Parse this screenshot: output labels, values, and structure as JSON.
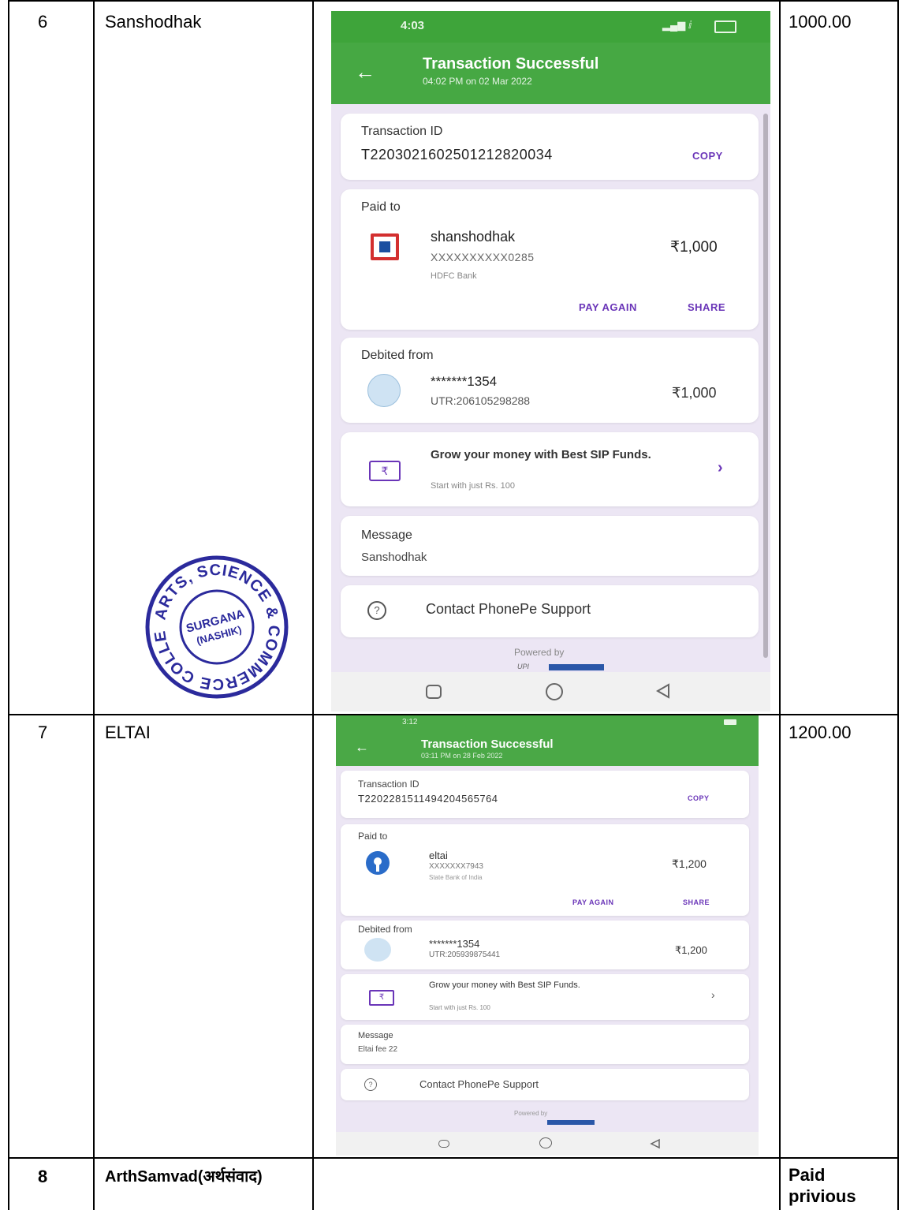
{
  "rows": [
    {
      "sr": "6",
      "name": "Sanshodhak",
      "amount": "1000.00",
      "receipt": {
        "time": "4:03",
        "status_icons": "signal-wifi-battery",
        "title": "Transaction Successful",
        "subtitle": "04:02 PM on 02 Mar 2022",
        "txn_label": "Transaction ID",
        "txn_id": "T2203021602501212820034",
        "copy": "COPY",
        "paid_to_label": "Paid to",
        "payee_name": "shanshodhak",
        "payee_account": "XXXXXXXXXX0285",
        "payee_bank": "HDFC Bank",
        "paid_amount": "₹1,000",
        "pay_again": "PAY AGAIN",
        "share": "SHARE",
        "debited_label": "Debited from",
        "debit_account": "*******1354",
        "utr": "UTR:206105298288",
        "debit_amount": "₹1,000",
        "promo_title": "Grow your money with Best SIP Funds.",
        "promo_sub": "Start with just Rs. 100",
        "message_label": "Message",
        "message": "Sanshodhak",
        "support": "Contact PhonePe Support",
        "powered_by": "Powered by"
      }
    },
    {
      "sr": "7",
      "name": "ELTAI",
      "amount": "1200.00",
      "receipt": {
        "time": "3:12",
        "title": "Transaction Successful",
        "subtitle": "03:11 PM on 28 Feb 2022",
        "txn_label": "Transaction ID",
        "txn_id": "T2202281511494204565764",
        "copy": "COPY",
        "paid_to_label": "Paid to",
        "payee_name": "eltai",
        "payee_account": "XXXXXXX7943",
        "payee_bank": "State Bank of India",
        "paid_amount": "₹1,200",
        "pay_again": "PAY AGAIN",
        "share": "SHARE",
        "debited_label": "Debited from",
        "debit_account": "*******1354",
        "utr": "UTR:205939875441",
        "debit_amount": "₹1,200",
        "promo_title": "Grow your money with Best SIP Funds.",
        "promo_sub": "Start with just Rs. 100",
        "message_label": "Message",
        "message": "Eltai fee 22",
        "support": "Contact PhonePe Support",
        "powered_by": "Powered by"
      }
    },
    {
      "sr": "8",
      "name": "ArthSamvad(अर्थसंवाद)",
      "amount_line1": "Paid",
      "amount_line2": "privious"
    }
  ],
  "stamp": {
    "outer": "ARTS, SCIENCE & COMMERCE COLLEGE",
    "inner1": "SURGANA",
    "inner2": "(NASHIK)"
  },
  "colors": {
    "phonepe_green": "#46a843",
    "phonepe_purple": "#6a35b8",
    "stamp_blue": "#2b2a9c"
  }
}
